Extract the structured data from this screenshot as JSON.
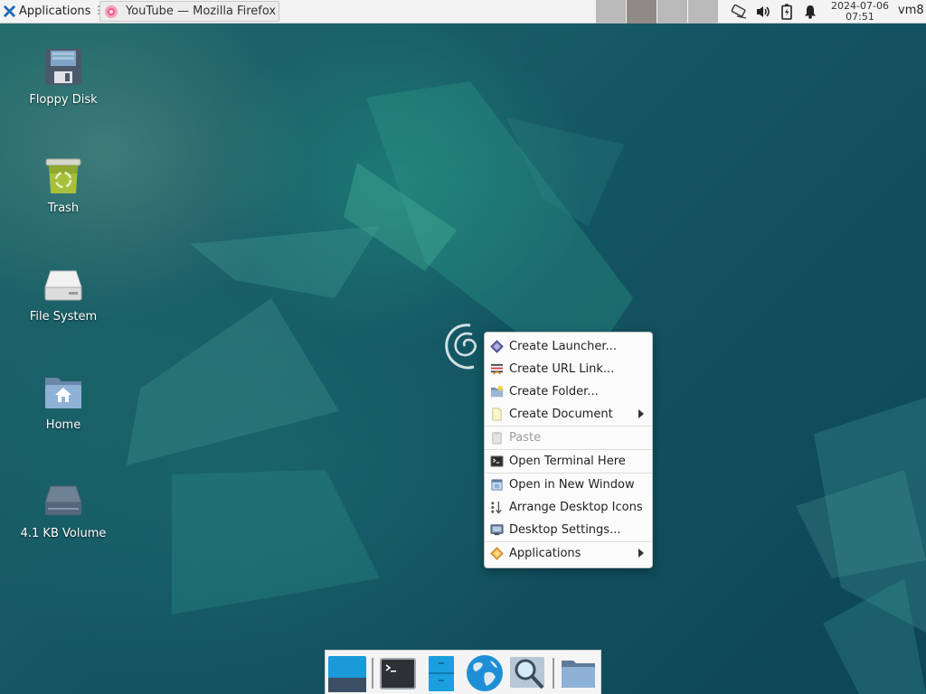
{
  "top_panel": {
    "applications_label": "Applications",
    "window_button_title": "YouTube — Mozilla Firefox",
    "workspaces": [
      {
        "active": false
      },
      {
        "active": true
      },
      {
        "active": false
      },
      {
        "active": false
      }
    ],
    "tray_icons": [
      "network-icon",
      "volume-icon",
      "battery-icon",
      "notification-bell-icon"
    ],
    "clock_date": "2024-07-06",
    "clock_time": "07:51",
    "user": "vm8"
  },
  "desktop_icons": [
    {
      "label": "Floppy Disk",
      "icon": "floppy-disk-icon"
    },
    {
      "label": "Trash",
      "icon": "trash-icon"
    },
    {
      "label": "File System",
      "icon": "file-system-icon"
    },
    {
      "label": "Home",
      "icon": "home-folder-icon"
    },
    {
      "label": "4.1 KB Volume",
      "icon": "volume-drive-icon"
    }
  ],
  "context_menu": {
    "items": [
      {
        "label": "Create Launcher...",
        "icon": "launcher-icon"
      },
      {
        "label": "Create URL Link...",
        "icon": "url-link-icon"
      },
      {
        "label": "Create Folder...",
        "icon": "folder-new-icon"
      },
      {
        "label": "Create Document",
        "icon": "document-icon",
        "submenu": true
      },
      {
        "label": "Paste",
        "icon": "paste-icon",
        "disabled": true
      },
      {
        "label": "Open Terminal Here",
        "icon": "terminal-icon"
      },
      {
        "label": "Open in New Window",
        "icon": "new-window-icon"
      },
      {
        "label": "Arrange Desktop Icons",
        "icon": "arrange-icons-icon"
      },
      {
        "label": "Desktop Settings...",
        "icon": "desktop-settings-icon"
      },
      {
        "label": "Applications",
        "icon": "applications-icon",
        "submenu": true
      }
    ]
  },
  "dock": {
    "items": [
      "show-desktop-icon",
      "terminal-icon",
      "file-manager-icon",
      "web-browser-icon",
      "app-finder-icon",
      "folder-icon"
    ]
  },
  "colors": {
    "panel_bg": "#f3f3f3",
    "desktop_bg": "#145663",
    "menu_bg": "#fbfbfb",
    "accent_blue": "#1f9bd6"
  }
}
